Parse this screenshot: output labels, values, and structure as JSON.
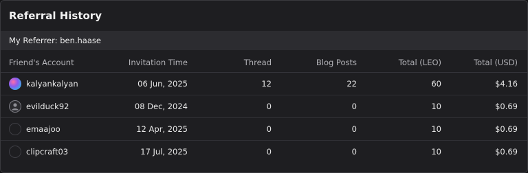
{
  "title": "Referral History",
  "referrer": "My Referrer: ben.haase",
  "table": {
    "headers": {
      "account": "Friend's Account",
      "time": "Invitation Time",
      "thread": "Thread",
      "blog": "Blog Posts",
      "leo": "Total (LEO)",
      "usd": "Total (USD)"
    },
    "rows": [
      {
        "avatar": "photo-avatar",
        "account": "kalyankalyan",
        "time": "06 Jun, 2025",
        "thread": "12",
        "blog": "22",
        "leo": "60",
        "usd": "$4.16"
      },
      {
        "avatar": "default-user-avatar",
        "account": "evilduck92",
        "time": "08 Dec, 2024",
        "thread": "0",
        "blog": "0",
        "leo": "10",
        "usd": "$0.69"
      },
      {
        "avatar": "empty-avatar",
        "account": "emaajoo",
        "time": "12 Apr, 2025",
        "thread": "0",
        "blog": "0",
        "leo": "10",
        "usd": "$0.69"
      },
      {
        "avatar": "empty-avatar",
        "account": "clipcraft03",
        "time": "17 Jul, 2025",
        "thread": "0",
        "blog": "0",
        "leo": "10",
        "usd": "$0.69"
      }
    ]
  }
}
